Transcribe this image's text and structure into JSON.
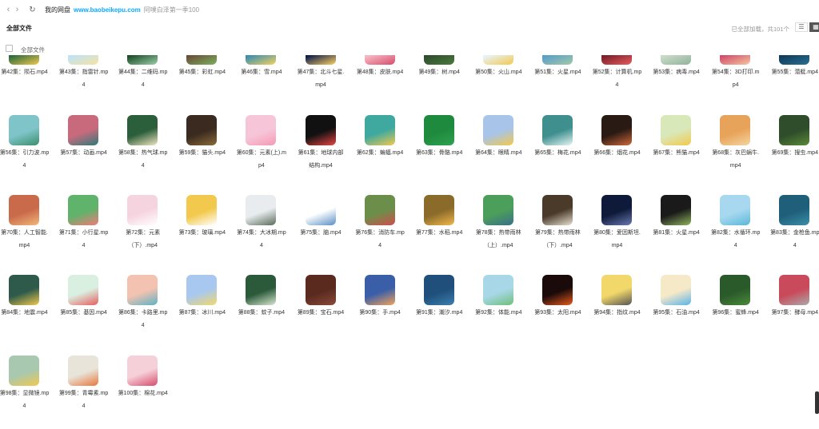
{
  "nav": {
    "back": "‹",
    "forward": "›",
    "refresh": "↻"
  },
  "breadcrumb": {
    "root": "我的网盘",
    "link": "www.baobeikepu.com",
    "current": "阿噗白泽第一季100"
  },
  "header": {
    "title": "全部文件",
    "count": "已全部加载，共101个"
  },
  "select_all": "全部文件",
  "files": [
    {
      "name": "第42集：陨石.mp4",
      "colors": [
        "#2d6b3f",
        "#f2c94c"
      ]
    },
    {
      "name": "第43集：指雷针.mp4",
      "colors": [
        "#bfe3f5",
        "#f7e3a1"
      ]
    },
    {
      "name": "第44集：二维码.mp4",
      "colors": [
        "#1e4d2b",
        "#9bd1a8"
      ]
    },
    {
      "name": "第45集：彩虹.mp4",
      "colors": [
        "#6b4f3a",
        "#7bb35e"
      ]
    },
    {
      "name": "第46集：雪.mp4",
      "colors": [
        "#3c8fb0",
        "#f4d35e"
      ]
    },
    {
      "name": "第47集：北斗七星.mp4",
      "colors": [
        "#0f1f4a",
        "#ffd166"
      ]
    },
    {
      "name": "第48集：皮肤.mp4",
      "colors": [
        "#f7b7c3",
        "#d64b6b"
      ]
    },
    {
      "name": "第49集：树.mp4",
      "colors": [
        "#2e4d2e",
        "#4c7a3d"
      ]
    },
    {
      "name": "第50集：火山.mp4",
      "colors": [
        "#e8f1f5",
        "#f2c94c"
      ]
    },
    {
      "name": "第51集：火星.mp4",
      "colors": [
        "#5a9fc9",
        "#a3c9a8"
      ]
    },
    {
      "name": "第52集：计算机.mp4",
      "colors": [
        "#7a1f2b",
        "#e85d5d"
      ]
    },
    {
      "name": "第53集：病毒.mp4",
      "colors": [
        "#c9d9c8",
        "#8fb39a"
      ]
    },
    {
      "name": "第54集：3D打印.mp4",
      "colors": [
        "#d04e6b",
        "#f7c7a1"
      ]
    },
    {
      "name": "第55集：潜艇.mp4",
      "colors": [
        "#0f3c5c",
        "#2b6f91"
      ]
    },
    {
      "name": "第56集：引力波.mp4",
      "colors": [
        "#7fc4c9",
        "#3b8f6b"
      ]
    },
    {
      "name": "第57集：动画.mp4",
      "colors": [
        "#c96a7c",
        "#2d7a7a"
      ]
    },
    {
      "name": "第58集：热气球.mp4",
      "colors": [
        "#2b5e3a",
        "#f3e6c3"
      ]
    },
    {
      "name": "第59集：猫头.mp4",
      "colors": [
        "#3a2a1f",
        "#8a6b3a"
      ]
    },
    {
      "name": "第60集：元素(上).mp4",
      "colors": [
        "#f6c6d8",
        "#f59ab5"
      ]
    },
    {
      "name": "第61集：地球内部结构.mp4",
      "colors": [
        "#111111",
        "#e84545"
      ]
    },
    {
      "name": "第62集：蝙蝠.mp4",
      "colors": [
        "#3fa9a0",
        "#f2c94c"
      ]
    },
    {
      "name": "第63集：骨骼.mp4",
      "colors": [
        "#1e8a3d",
        "#2fa24f"
      ]
    },
    {
      "name": "第64集：眼睛.mp4",
      "colors": [
        "#a8c4e8",
        "#f2c94c"
      ]
    },
    {
      "name": "第65集：梅花.mp4",
      "colors": [
        "#3f8f8f",
        "#e8f4f4"
      ]
    },
    {
      "name": "第66集：烟花.mp4",
      "colors": [
        "#2a1a14",
        "#d06a3a"
      ]
    },
    {
      "name": "第67集：熊猫.mp4",
      "colors": [
        "#d9e8b8",
        "#f2c94c"
      ]
    },
    {
      "name": "第68集：灰巴蜗牛.mp4",
      "colors": [
        "#e8a35a",
        "#f4d6a1"
      ]
    },
    {
      "name": "第69集：搜虫.mp4",
      "colors": [
        "#2f4d2a",
        "#5c8a3a"
      ]
    },
    {
      "name": "第70集：人工智能.mp4",
      "colors": [
        "#c96a4a",
        "#f2b87a"
      ]
    },
    {
      "name": "第71集：小行星.mp4",
      "colors": [
        "#5fb36b",
        "#f27a7a"
      ]
    },
    {
      "name": "第72集：元素（下）.mp4",
      "colors": [
        "#f6d4df",
        "#ffffff"
      ]
    },
    {
      "name": "第73集：玻璃.mp4",
      "colors": [
        "#f2c94c",
        "#ffffff"
      ]
    },
    {
      "name": "第74集：大冰期.mp4",
      "colors": [
        "#e8ecef",
        "#5a6a5a"
      ]
    },
    {
      "name": "第75集：脑.mp4",
      "colors": [
        "#ffffff",
        "#5a8fc4"
      ]
    },
    {
      "name": "第76集：消防车.mp4",
      "colors": [
        "#6b8f4a",
        "#d04e4e"
      ]
    },
    {
      "name": "第77集：水稻.mp4",
      "colors": [
        "#8a6b2a",
        "#f2b84c"
      ]
    },
    {
      "name": "第78集：热带雨林（上）.mp4",
      "colors": [
        "#4c9f5a",
        "#3a6f8a"
      ]
    },
    {
      "name": "第79集：热带雨林（下）.mp4",
      "colors": [
        "#4a3a2a",
        "#e8e0d0"
      ]
    },
    {
      "name": "第80集：爱因斯坦.mp4",
      "colors": [
        "#0f1a3a",
        "#6a7ab0"
      ]
    },
    {
      "name": "第81集：火星.mp4",
      "colors": [
        "#1a1a1a",
        "#8fb35e"
      ]
    },
    {
      "name": "第82集：水循环.mp4",
      "colors": [
        "#a8d8f0",
        "#5ab8d8"
      ]
    },
    {
      "name": "第83集：金枪鱼.mp4",
      "colors": [
        "#1f5f7a",
        "#3a8fa8"
      ]
    },
    {
      "name": "第84集：地震.mp4",
      "colors": [
        "#2d5a4a",
        "#f2c94c"
      ]
    },
    {
      "name": "第85集：基因.mp4",
      "colors": [
        "#d9efe0",
        "#e85d5d"
      ]
    },
    {
      "name": "第86集：卡路里.mp4",
      "colors": [
        "#f4c2b0",
        "#5ab3c4"
      ]
    },
    {
      "name": "第87集：冰川.mp4",
      "colors": [
        "#a8c8f0",
        "#f2d86a"
      ]
    },
    {
      "name": "第88集：蚊子.mp4",
      "colors": [
        "#2a5a3a",
        "#d9e8d0"
      ]
    },
    {
      "name": "第89集：宝石.mp4",
      "colors": [
        "#5a2a1f",
        "#8a4a3a"
      ]
    },
    {
      "name": "第90集：手.mp4",
      "colors": [
        "#3a5fa8",
        "#f2a35a"
      ]
    },
    {
      "name": "第91集：潮汐.mp4",
      "colors": [
        "#1f4f7a",
        "#3a7fb0"
      ]
    },
    {
      "name": "第92集：体能.mp4",
      "colors": [
        "#a8d8e8",
        "#6fbf7a"
      ]
    },
    {
      "name": "第93集：太阳.mp4",
      "colors": [
        "#1a0a0a",
        "#e85a1a"
      ]
    },
    {
      "name": "第94集：指纹.mp4",
      "colors": [
        "#f2d86a",
        "#555555"
      ]
    },
    {
      "name": "第95集：石油.mp4",
      "colors": [
        "#f6e9c8",
        "#5ab3e8"
      ]
    },
    {
      "name": "第96集：蜜蜂.mp4",
      "colors": [
        "#2a5a2a",
        "#4a8a3a"
      ]
    },
    {
      "name": "第97集：酵母.mp4",
      "colors": [
        "#c94a5a",
        "#aaaaaa"
      ]
    },
    {
      "name": "第98集：显微镜.mp4",
      "colors": [
        "#a8c8b0",
        "#f2c94c"
      ]
    },
    {
      "name": "第99集：青霉素.mp4",
      "colors": [
        "#e8e4da",
        "#e8783a"
      ]
    },
    {
      "name": "第100集：棉花.mp4",
      "colors": [
        "#f6d0d8",
        "#d64b6b"
      ]
    }
  ]
}
